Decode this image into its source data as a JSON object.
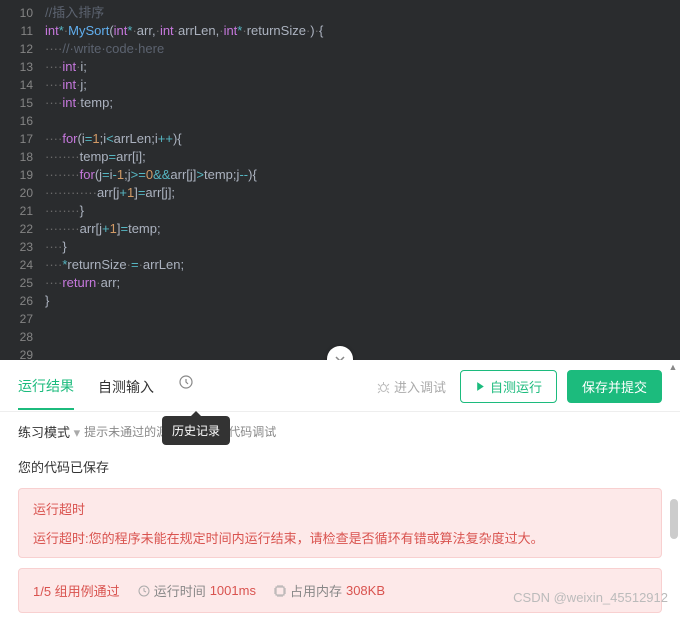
{
  "editor": {
    "lines": [
      {
        "n": 10,
        "html": "<span class='cm'>//插入排序</span>"
      },
      {
        "n": 11,
        "html": "<span class='ty'>int</span><span class='op'>*</span><span class='w'>·</span><span class='fn'>MySort</span><span class='pn'>(</span><span class='ty'>int</span><span class='op'>*</span><span class='w'>·</span><span class='id'>arr</span><span class='pn'>,</span><span class='w'>·</span><span class='ty'>int</span><span class='w'>·</span><span class='id'>arrLen</span><span class='pn'>,</span><span class='w'>·</span><span class='ty'>int</span><span class='op'>*</span><span class='w'>·</span><span class='id'>returnSize</span><span class='w'>·</span><span class='pn'>)</span><span class='w'>·</span><span class='pn'>{</span>"
      },
      {
        "n": 12,
        "html": "<span class='w'>····</span><span class='cm'>//·write·code·here</span>"
      },
      {
        "n": 13,
        "html": "<span class='w'>····</span><span class='ty'>int</span><span class='w'>·</span><span class='id'>i</span><span class='pn'>;</span>"
      },
      {
        "n": 14,
        "html": "<span class='w'>····</span><span class='ty'>int</span><span class='w'>·</span><span class='id'>j</span><span class='pn'>;</span>"
      },
      {
        "n": 15,
        "html": "<span class='w'>····</span><span class='ty'>int</span><span class='w'>·</span><span class='id'>temp</span><span class='pn'>;</span>"
      },
      {
        "n": 16,
        "html": ""
      },
      {
        "n": 17,
        "html": "<span class='w'>····</span><span class='kw'>for</span><span class='pn'>(</span><span class='id'>i</span><span class='op'>=</span><span class='nm'>1</span><span class='pn'>;</span><span class='id'>i</span><span class='op'>&lt;</span><span class='id'>arrLen</span><span class='pn'>;</span><span class='id'>i</span><span class='op'>++</span><span class='pn'>){</span>"
      },
      {
        "n": 18,
        "html": "<span class='w'>········</span><span class='id'>temp</span><span class='op'>=</span><span class='id'>arr</span><span class='pn'>[</span><span class='id'>i</span><span class='pn'>];</span>"
      },
      {
        "n": 19,
        "html": "<span class='w'>········</span><span class='kw'>for</span><span class='pn'>(</span><span class='id'>j</span><span class='op'>=</span><span class='id'>i</span><span class='op'>-</span><span class='nm'>1</span><span class='pn'>;</span><span class='id'>j</span><span class='op'>&gt;=</span><span class='nm'>0</span><span class='op'>&amp;&amp;</span><span class='id'>arr</span><span class='pn'>[</span><span class='id'>j</span><span class='pn'>]</span><span class='op'>&gt;</span><span class='id'>temp</span><span class='pn'>;</span><span class='id'>j</span><span class='op'>--</span><span class='pn'>){</span>"
      },
      {
        "n": 20,
        "html": "<span class='w'>············</span><span class='id'>arr</span><span class='pn'>[</span><span class='id'>j</span><span class='op'>+</span><span class='nm'>1</span><span class='pn'>]</span><span class='op'>=</span><span class='id'>arr</span><span class='pn'>[</span><span class='id'>j</span><span class='pn'>];</span>"
      },
      {
        "n": 21,
        "html": "<span class='w'>········</span><span class='pn'>}</span>"
      },
      {
        "n": 22,
        "html": "<span class='w'>········</span><span class='id'>arr</span><span class='pn'>[</span><span class='id'>j</span><span class='op'>+</span><span class='nm'>1</span><span class='pn'>]</span><span class='op'>=</span><span class='id'>temp</span><span class='pn'>;</span>"
      },
      {
        "n": 23,
        "html": "<span class='w'>····</span><span class='pn'>}</span>"
      },
      {
        "n": 24,
        "html": "<span class='w'>····</span><span class='op'>*</span><span class='id'>returnSize</span><span class='w'>·</span><span class='op'>=</span><span class='w'>·</span><span class='id'>arrLen</span><span class='pn'>;</span>"
      },
      {
        "n": 25,
        "html": "<span class='w'>····</span><span class='kw'>return</span><span class='w'>·</span><span class='id'>arr</span><span class='pn'>;</span>"
      },
      {
        "n": 26,
        "html": "<span class='pn'>}</span>"
      },
      {
        "n": 27,
        "html": ""
      },
      {
        "n": 28,
        "html": ""
      },
      {
        "n": 29,
        "html": ""
      }
    ]
  },
  "tabs": {
    "result": "运行结果",
    "selftest": "自测输入"
  },
  "buttons": {
    "debug": "进入调试",
    "selftest_run": "自测运行",
    "save_submit": "保存并提交"
  },
  "tooltip": "历史记录",
  "mode": {
    "label": "练习模式",
    "hint_before": "提示未通过的源",
    "hint_after": "于代码调试"
  },
  "saved": "您的代码已保存",
  "error": {
    "title": "运行超时",
    "msg": "运行超时:您的程序未能在规定时间内运行结束，请检查是否循环有错或算法复杂度过大。"
  },
  "stats": {
    "pass": "1/5 组用例通过",
    "time_label": "运行时间",
    "time_val": "1001ms",
    "mem_label": "占用内存",
    "mem_val": "308KB"
  },
  "watermark": "CSDN @weixin_45512912"
}
